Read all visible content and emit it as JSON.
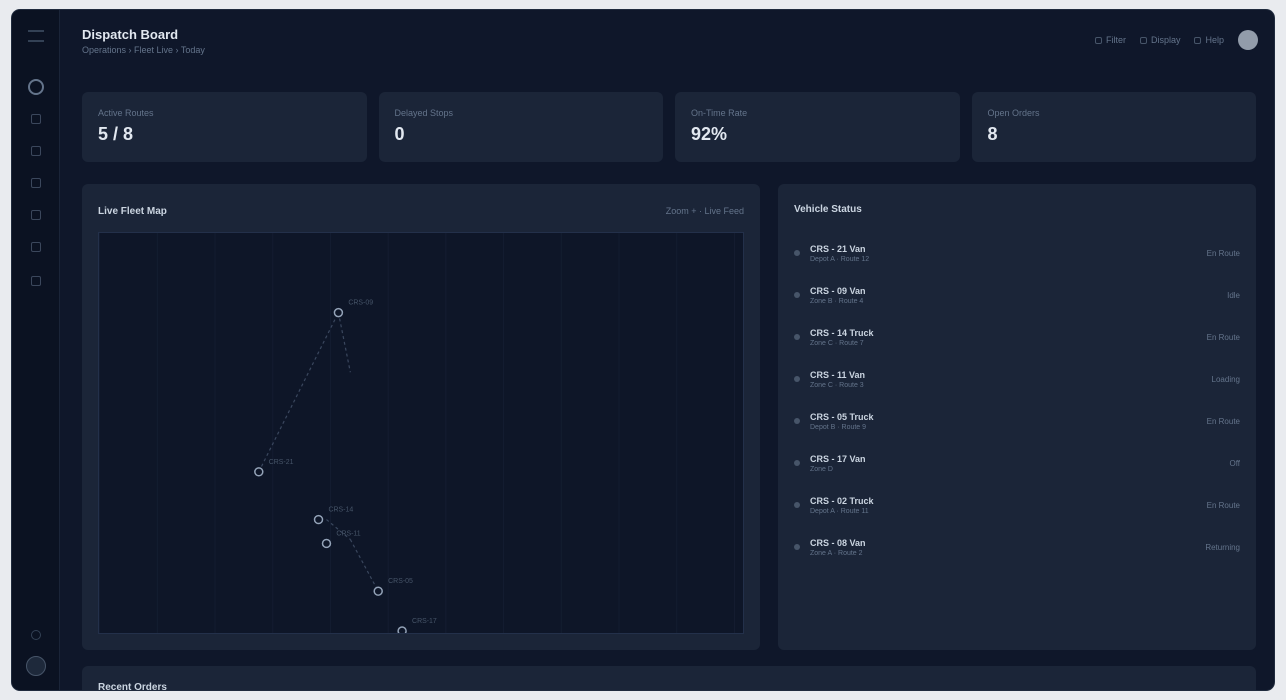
{
  "header": {
    "title": "Dispatch Board",
    "breadcrumb": "Operations › Fleet Live › Today",
    "actions": [
      {
        "label": "Filter",
        "icon": "filter-icon"
      },
      {
        "label": "Display",
        "icon": "display-icon"
      },
      {
        "label": "Help",
        "icon": "help-icon"
      }
    ]
  },
  "sidebar": {
    "items": [
      {
        "icon": "dashboard-icon"
      },
      {
        "icon": "map-icon"
      },
      {
        "icon": "truck-icon"
      },
      {
        "icon": "route-icon"
      },
      {
        "icon": "calendar-icon"
      },
      {
        "icon": "reports-icon"
      },
      {
        "icon": "settings-icon"
      }
    ]
  },
  "stats": [
    {
      "label": "Active Routes",
      "value": "5 / 8"
    },
    {
      "label": "Delayed Stops",
      "value": "0"
    },
    {
      "label": "On-Time Rate",
      "value": "92%"
    },
    {
      "label": "Open Orders",
      "value": "8"
    }
  ],
  "map": {
    "title": "Live Fleet Map",
    "tools": "Zoom + · Live Feed",
    "routes": [
      {
        "from": [
          2,
          6
        ],
        "to": [
          4,
          2
        ]
      },
      {
        "from": [
          4,
          2
        ],
        "to": [
          4.3,
          3.5
        ]
      },
      {
        "from": [
          3.7,
          7.2
        ],
        "to": [
          4.3,
          7.7
        ]
      },
      {
        "from": [
          4.3,
          7.7
        ],
        "to": [
          5,
          9
        ]
      }
    ],
    "vehicles": [
      {
        "label": "CRS-21",
        "pos": [
          2,
          6
        ]
      },
      {
        "label": "CRS-09",
        "pos": [
          4,
          2
        ]
      },
      {
        "label": "CRS-14",
        "pos": [
          3.5,
          7.2
        ]
      },
      {
        "label": "CRS-11",
        "pos": [
          3.7,
          7.8
        ]
      },
      {
        "label": "CRS-05",
        "pos": [
          5,
          9
        ]
      },
      {
        "label": "CRS-17",
        "pos": [
          5.6,
          10
        ]
      }
    ]
  },
  "vehicle_list": {
    "title": "Vehicle Status",
    "rows": [
      {
        "name": "CRS - 21 Van",
        "sub": "Depot A · Route 12",
        "value": "En Route"
      },
      {
        "name": "CRS - 09 Van",
        "sub": "Zone B · Route 4",
        "value": "Idle"
      },
      {
        "name": "CRS - 14 Truck",
        "sub": "Zone C · Route 7",
        "value": "En Route"
      },
      {
        "name": "CRS - 11 Van",
        "sub": "Zone C · Route 3",
        "value": "Loading"
      },
      {
        "name": "CRS - 05 Truck",
        "sub": "Depot B · Route 9",
        "value": "En Route"
      },
      {
        "name": "CRS - 17 Van",
        "sub": "Zone D",
        "value": "Off"
      },
      {
        "name": "CRS - 02 Truck",
        "sub": "Depot A · Route 11",
        "value": "En Route"
      },
      {
        "name": "CRS - 08 Van",
        "sub": "Zone A · Route 2",
        "value": "Returning"
      }
    ]
  },
  "bottom": {
    "title": "Recent Orders"
  }
}
